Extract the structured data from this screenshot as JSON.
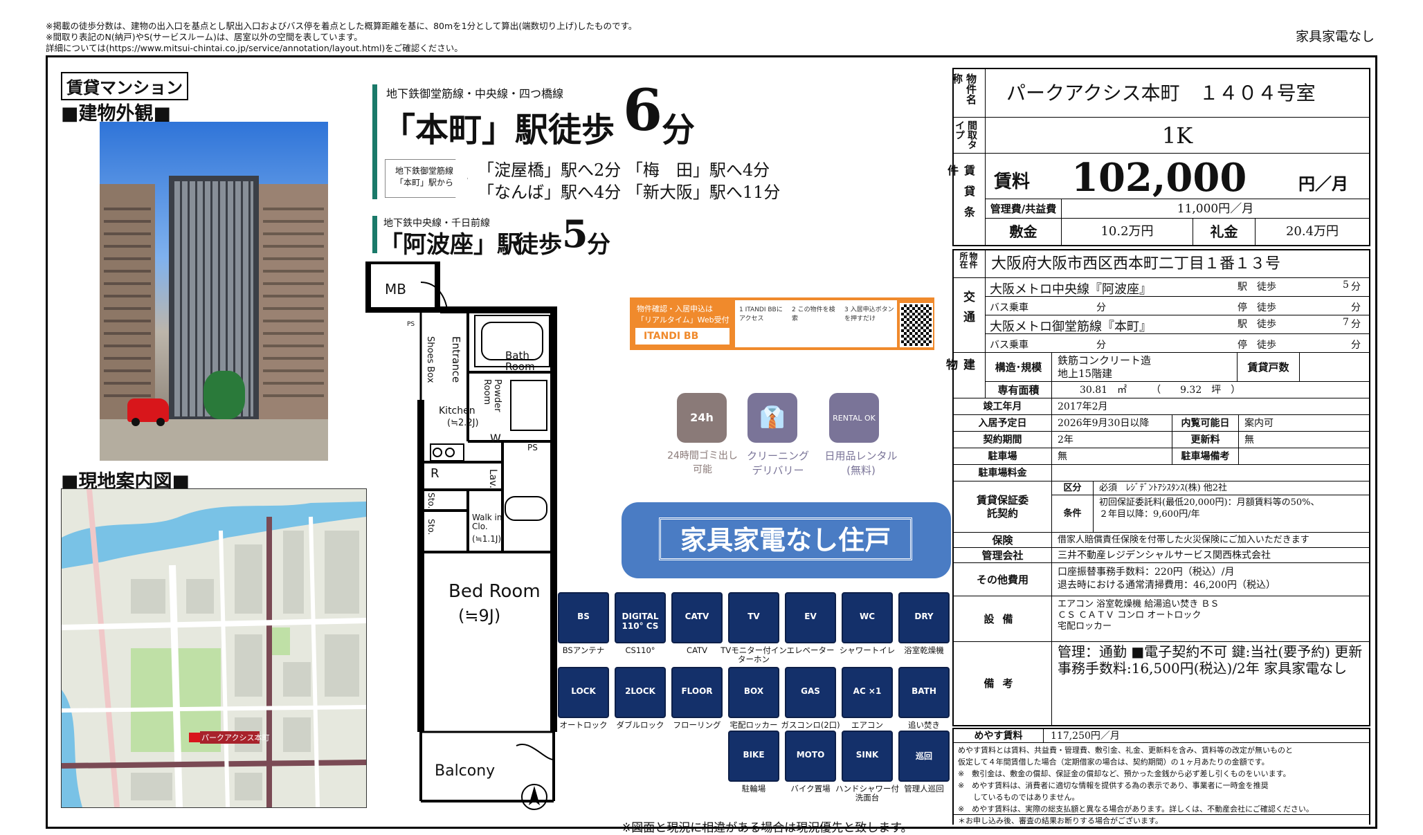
{
  "notes": [
    "※掲載の徒歩分数は、建物の出入口を基点とし駅出入口およびバス停を着点とした概算距離を基に、80mを1分として算出(端数切り上げ)したものです。",
    "※間取り表記のN(納戸)やS(サービスルーム)は、居室以外の空間を表しています。",
    "詳細については(https://www.mitsui-chintai.co.jp/service/annotation/layout.html)をご確認ください。"
  ],
  "top_right_label": "家具家電なし",
  "left": {
    "badge": "賃貸マンション",
    "exterior_heading": "■建物外観■",
    "map_heading": "■現地案内図■",
    "map_pin_label": "パークアクシス本町"
  },
  "access": {
    "line1_caption": "地下鉄御堂筋線・中央線・四つ橋線",
    "station1": "「本町」駅",
    "walk1_prefix": "徒歩",
    "walk1_num": "6",
    "walk1_unit": "分",
    "from_caption": "地下鉄御堂筋線「本町」駅から",
    "routes_row1": "「淀屋橋」駅へ2分 「梅　田」駅へ4分",
    "routes_row2": "「なんば」駅へ4分 「新大阪」駅へ11分",
    "line2_caption": "地下鉄中央線・千日前線",
    "station2": "「阿波座」駅",
    "walk2_prefix": "徒歩",
    "walk2_num": "5",
    "walk2_unit": "分"
  },
  "itandi": {
    "left_text1": "物件確認・入居申込は",
    "left_text2": "「リアルタイム」Web受付",
    "brand": "ITANDI BB",
    "step1": "1 ITANDI BBにアクセス",
    "step2": "2 この物件を検索",
    "step3": "3 入居申込ボタンを押すだけ"
  },
  "service_icons": [
    {
      "name": "24時間ゴミ出し可能",
      "glyph": "24h"
    },
    {
      "name": "クリーニング デリバリー",
      "glyph": "shirt"
    },
    {
      "name": "日用品レンタル (無料)",
      "glyph": "RENTAL OK"
    }
  ],
  "furniture_banner": "家具家電なし住戸",
  "floorplan": {
    "mb": "MB",
    "ps": "PS",
    "entrance": "Entrance",
    "shoes_box": "Shoes Box",
    "bath": "Bath Room",
    "powder": "Powder Room",
    "kitchen": "Kitchen",
    "kitchen_size": "(≒2.2J)",
    "w": "W",
    "ps2": "PS",
    "r": "R",
    "lav": "Lav.",
    "sto1": "Sto.",
    "sto2": "Sto.",
    "walkin": "Walk in Clo.",
    "walkin_size": "(≒1.1J)",
    "bedroom": "Bed Room",
    "bedroom_size": "(≒9J)",
    "balcony": "Balcony"
  },
  "equip_icons": [
    {
      "label": "BSアンテナ",
      "glyph": "BS"
    },
    {
      "label": "CS110°",
      "glyph": "DIGITAL 110° CS"
    },
    {
      "label": "CATV",
      "glyph": "CATV"
    },
    {
      "label": "TVモニター付インターホン",
      "glyph": "TV"
    },
    {
      "label": "エレベーター",
      "glyph": "EV"
    },
    {
      "label": "シャワートイレ",
      "glyph": "WC"
    },
    {
      "label": "浴室乾燥機",
      "glyph": "DRY"
    },
    {
      "label": "オートロック",
      "glyph": "LOCK"
    },
    {
      "label": "ダブルロック",
      "glyph": "2LOCK"
    },
    {
      "label": "フローリング",
      "glyph": "FLOOR"
    },
    {
      "label": "宅配ロッカー",
      "glyph": "BOX"
    },
    {
      "label": "ガスコンロ(2口)",
      "glyph": "GAS"
    },
    {
      "label": "エアコン",
      "glyph": "AC ×1"
    },
    {
      "label": "追い焚き",
      "glyph": "BATH"
    },
    {
      "label": "駐輪場",
      "glyph": "BIKE"
    },
    {
      "label": "バイク置場",
      "glyph": "MOTO"
    },
    {
      "label": "ハンドシャワー付洗面台",
      "glyph": "SINK"
    },
    {
      "label": "管理人巡回",
      "glyph": "巡回"
    }
  ],
  "plan_note": "※図面と現況に相違がある場合は現況優先と致します。",
  "property": {
    "name_label": "物件名称",
    "name": "パークアクシス本町　１４０４号室",
    "type_label": "間取タイプ",
    "type": "1K",
    "terms_label": "賃貸条件",
    "rent_label": "賃料",
    "rent": "102,000",
    "rent_unit": "円／月",
    "mgmt_label": "管理費/共益費",
    "mgmt": "11,000円／月",
    "deposit_label": "敷金",
    "deposit": "10.2万円",
    "key_label": "礼金",
    "key": "20.4万円",
    "address_label": "物件所在",
    "address": "大阪府大阪市西区西本町二丁目１番１３号",
    "traffic_label": "交通",
    "traffic": [
      {
        "line": "大阪メトロ中央線『阿波座』",
        "mid": "駅　徒歩",
        "val": "5",
        "unit": "分"
      },
      {
        "line": "バス乗車",
        "pre": "分",
        "mid": "停　徒歩",
        "val": "",
        "unit": "分"
      },
      {
        "line": "大阪メトロ御堂筋線『本町』",
        "mid": "駅　徒歩",
        "val": "7",
        "unit": "分"
      },
      {
        "line": "バス乗車",
        "pre": "分",
        "mid": "停　徒歩",
        "val": "",
        "unit": "分"
      }
    ],
    "building_label": "建物",
    "structure_label": "構造･規模",
    "structure1": "鉄筋コンクリート造",
    "structure2": "地上15階建",
    "units_label": "賃貸戸数",
    "area_label": "専有面積",
    "area": "30.81　㎡　　　（　　9.32　坪　）",
    "built_label": "竣工年月",
    "built": "2017年2月",
    "movein_label": "入居予定日",
    "movein": "2026年9月30日以降",
    "preview_label": "内覧可能日",
    "preview": "案内可",
    "period_label": "契約期間",
    "period": "2年",
    "renew_label": "更新料",
    "renew": "無",
    "parking_label": "駐車場",
    "parking": "無",
    "parking_note_label": "駐車場備考",
    "parking_fee_label": "駐車場料金",
    "guarantee_label": "賃貸保証委託契約",
    "kubun_label": "区分",
    "kubun": "必須　ﾚｼﾞﾃﾞﾝﾄｱｼｽﾀﾝｽ(株) 他2社",
    "joken_label": "条件",
    "joken1": "初回保証委託料(最低20,000円)：月額賃料等の50%、",
    "joken2": "２年目以降：9,600円/年",
    "insurance_label": "保険",
    "insurance": "借家人賠償責任保険を付帯した火災保険にご加入いただきます",
    "company_label": "管理会社",
    "company": "三井不動産レジデンシャルサービス関西株式会社",
    "other_label": "その他費用",
    "other1": "口座振替事務手数料：220円（税込）/月",
    "other2": "退去時における通常清掃費用：46,200円（税込）",
    "equip_label": "設備",
    "equip1": "エアコン 浴室乾燥機 給湯追い焚き ＢＳ",
    "equip2": "ＣＳ ＣＡＴＶ コンロ オートロック",
    "equip3": "宅配ロッカー",
    "remarks_label": "備考",
    "remarks": "管理：通勤 ■電子契約不可 鍵:当社(要予約) 更新事務手数料:16,500円(税込)/2年 家具家電なし",
    "meyasu_label": "めやす賃料",
    "meyasu": "117,250円／月",
    "meyasu_notes": [
      "めやす賃料とは賃料、共益費・管理費、敷引金、礼金、更新料を含み、賃料等の改定が無いものと",
      "仮定して４年間賃借した場合（定期借家の場合は、契約期間）の１ヶ月あたりの金額です。",
      "※　敷引金は、敷金の償却、保証金の償却など、預かった金銭から必ず差し引くものをいいます。",
      "※　めやす賃料は、消費者に適切な情報を提供する為の表示であり、事業者に一時金を推奨",
      "　　しているものではありません。",
      "※　めやす賃料は、実際の総支払額と異なる場合があります。詳しくは、不動産会社にご確認ください。"
    ],
    "final_note": "＊お申し込み後、審査の結果お断りする場合がございます。"
  }
}
